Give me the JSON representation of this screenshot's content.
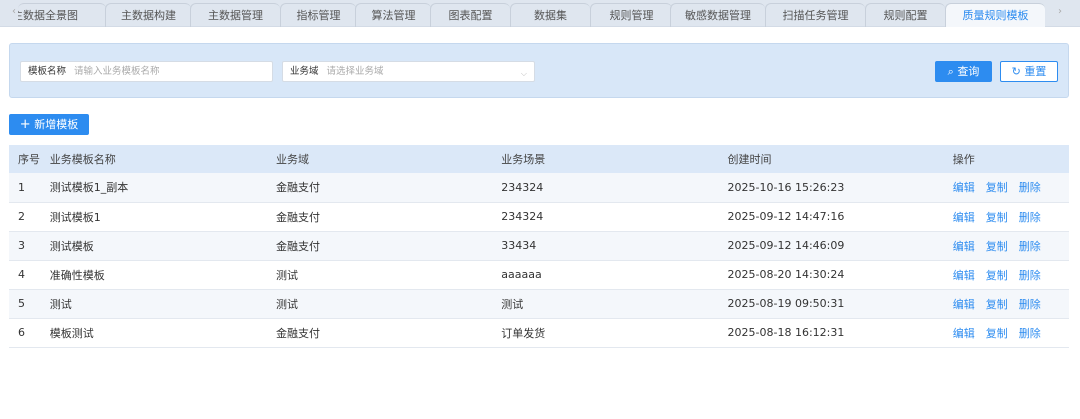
{
  "tabs": [
    "主数据全景图",
    "主数据构建",
    "主数据管理",
    "指标管理",
    "算法管理",
    "图表配置",
    "数据集",
    "规则管理",
    "敏感数据管理",
    "扫描任务管理",
    "规则配置",
    "质量规则模板"
  ],
  "active_tab": "质量规则模板",
  "nav": {
    "prev": "‹",
    "next": "›"
  },
  "search": {
    "name_label": "模板名称",
    "name_placeholder": "请输入业务模板名称",
    "domain_label": "业务域",
    "domain_placeholder": "请选择业务域",
    "query": "查询",
    "reset": "重置"
  },
  "add_button": "新增模板",
  "table": {
    "columns": [
      "序号",
      "业务模板名称",
      "业务域",
      "业务场景",
      "创建时间",
      "操作"
    ],
    "rows": [
      [
        "1",
        "测试模板1_副本",
        "金融支付",
        "234324",
        "2025-10-16 15:26:23"
      ],
      [
        "2",
        "测试模板1",
        "金融支付",
        "234324",
        "2025-09-12 14:47:16"
      ],
      [
        "3",
        "测试模板",
        "金融支付",
        "33434",
        "2025-09-12 14:46:09"
      ],
      [
        "4",
        "准确性模板",
        "测试",
        "aaaaaa",
        "2025-08-20 14:30:24"
      ],
      [
        "5",
        "测试",
        "测试",
        "测试",
        "2025-08-19 09:50:31"
      ],
      [
        "6",
        "模板测试",
        "金融支付",
        "订单发货",
        "2025-08-18 16:12:31"
      ]
    ],
    "actions": [
      "编辑",
      "复制",
      "删除"
    ]
  },
  "colors": {
    "accent": "#2d8cf0",
    "header_bg": "#dbe8f8",
    "search_bg": "#d8e7f8"
  }
}
